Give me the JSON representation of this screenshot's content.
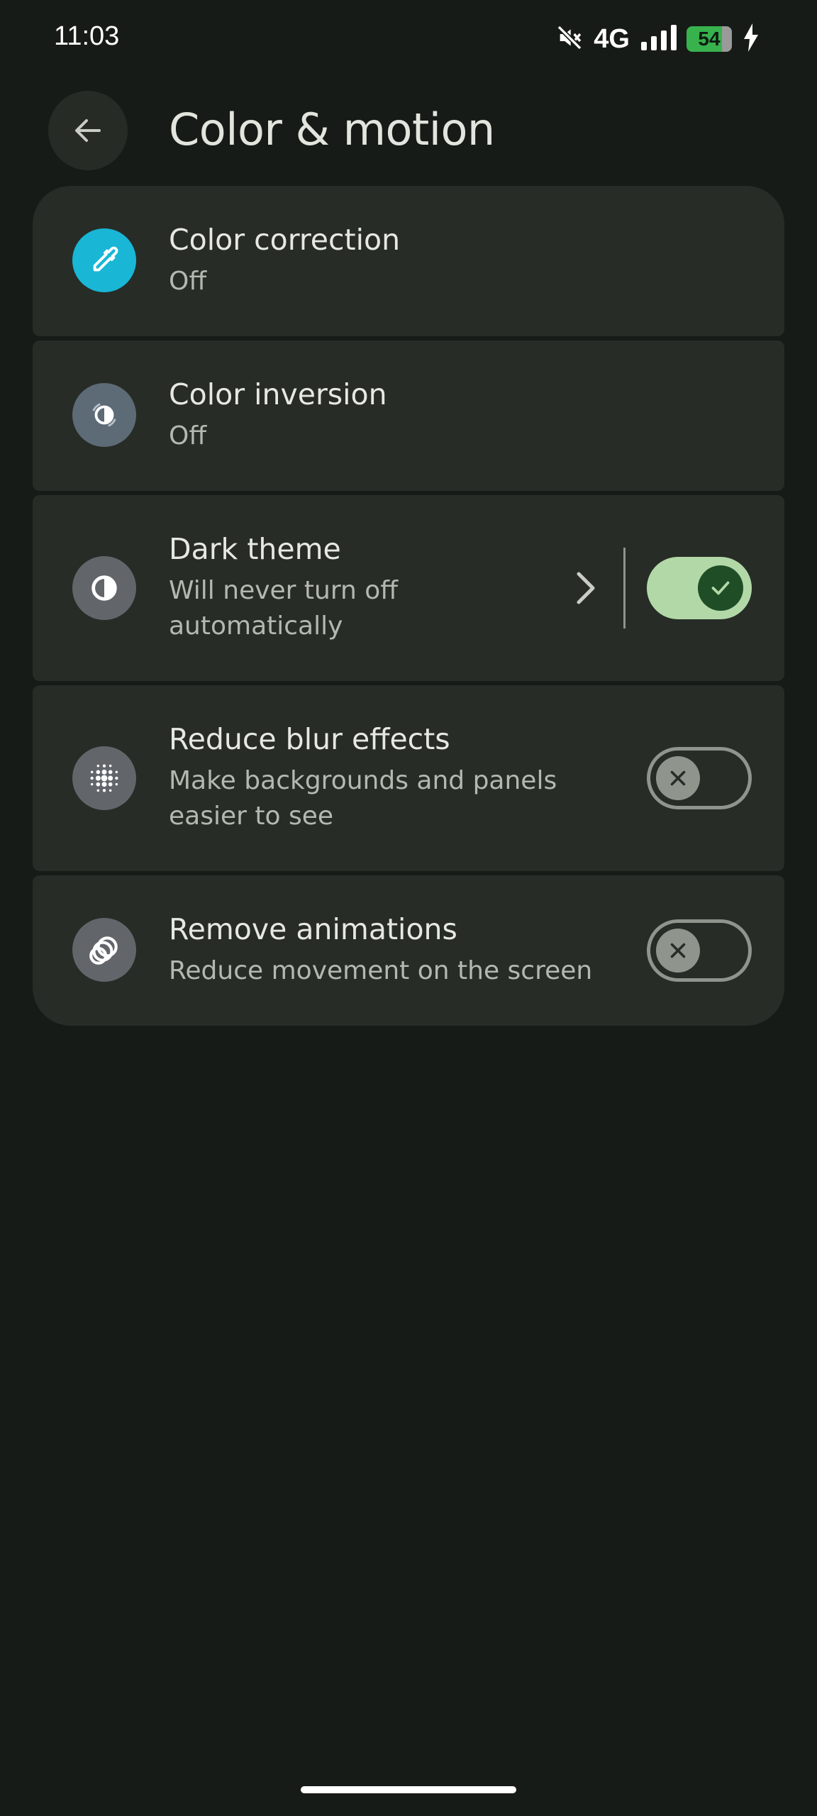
{
  "status_bar": {
    "time": "11:03",
    "network": "4G",
    "battery_percent": "54",
    "icons": [
      "mute-icon",
      "signal-icon",
      "battery-icon",
      "charging-icon"
    ]
  },
  "app_bar": {
    "title": "Color & motion",
    "back_icon": "arrow-back-icon"
  },
  "settings": [
    {
      "title": "Color correction",
      "subtitle": "Off",
      "icon": "eyedropper-icon",
      "icon_bg": "#19b6d6"
    },
    {
      "title": "Color inversion",
      "subtitle": "Off",
      "icon": "color-inversion-icon",
      "icon_bg": "#5d6b77"
    },
    {
      "title": "Dark theme",
      "subtitle": "Will never turn off automatically",
      "subtitle_lines": [
        "Will never turn off",
        "automatically"
      ],
      "icon": "contrast-icon",
      "icon_bg": "#62666a",
      "toggle": "on",
      "has_chevron": true
    },
    {
      "title": "Reduce blur effects",
      "subtitle": "Make backgrounds and panels easier to see",
      "subtitle_lines": [
        "Make backgrounds and panels",
        "easier to see"
      ],
      "icon": "blur-icon",
      "icon_bg": "#62666a",
      "toggle": "off"
    },
    {
      "title": "Remove animations",
      "subtitle": "Reduce movement on the screen",
      "icon": "animation-rings-icon",
      "icon_bg": "#62666a",
      "toggle": "off"
    }
  ],
  "colors": {
    "background": "#171b17",
    "card": "#272c27",
    "toggle_on_track": "#b3d8a8",
    "toggle_on_thumb": "#1f4d26",
    "toggle_off": "#8f948c",
    "battery": "#37b24d"
  }
}
